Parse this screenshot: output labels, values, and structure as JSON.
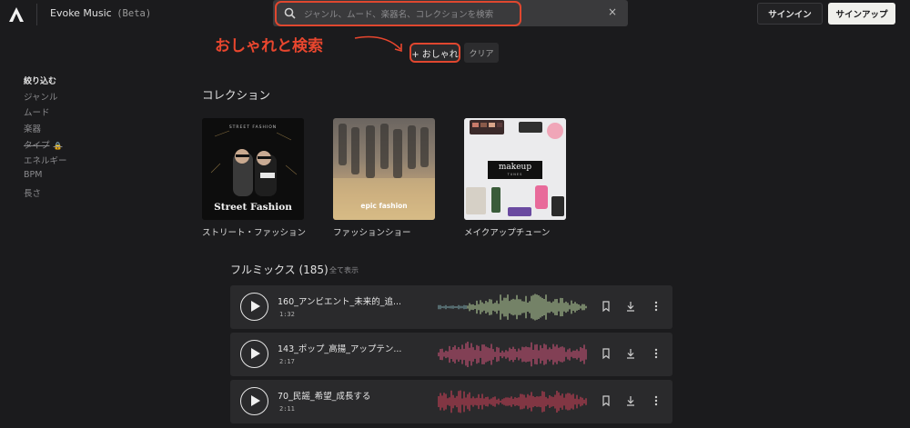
{
  "header": {
    "brand": "Evoke Music",
    "beta": "(Beta)",
    "search_placeholder": "ジャンル、ムード、楽器名、コレクションを検索",
    "close_glyph": "×",
    "signin_label": "サインイン",
    "signup_label": "サインアップ"
  },
  "annotation": {
    "text": "おしゃれと検索"
  },
  "active_tag": {
    "label": "+ おしゃれ",
    "clear_label": "クリア"
  },
  "sidebar": {
    "title": "絞り込む",
    "items": [
      {
        "label": "ジャンル"
      },
      {
        "label": "ムード"
      },
      {
        "label": "楽器"
      },
      {
        "label": "タイプ",
        "locked": true
      },
      {
        "label": "エネルギー"
      },
      {
        "label": "BPM"
      },
      {
        "label": "長さ"
      }
    ]
  },
  "collections": {
    "title": "コレクション",
    "items": [
      {
        "label": "ストリート・ファッション",
        "cover_text": "Street Fashion",
        "cover_small": "STREET FASHION"
      },
      {
        "label": "ファッションショー",
        "cover_text": "epic fashion"
      },
      {
        "label": "メイクアップチューン",
        "cover_text": "makeup",
        "cover_small": "TUNES"
      }
    ]
  },
  "mixes": {
    "title": "フルミックス (185)",
    "show_all": "全て表示",
    "tracks": [
      {
        "name": "160_アンビエント_未来的_追...",
        "duration": "1:32",
        "wave_color": "#bfd9a2"
      },
      {
        "name": "143_ポップ_高揚_アップテン...",
        "duration": "2:17",
        "wave_color": "#d9577e"
      },
      {
        "name": "70_民謡_希望_成長する",
        "duration": "2:11",
        "wave_color": "#d8415a"
      }
    ]
  },
  "colors": {
    "accent": "#e0472f",
    "background": "#1b1b1d",
    "row": "#2a2a2c"
  },
  "icons": [
    "app-logo-icon",
    "search-icon",
    "close-icon",
    "lock-icon",
    "play-icon",
    "bookmark-icon",
    "download-icon",
    "more-icon"
  ]
}
